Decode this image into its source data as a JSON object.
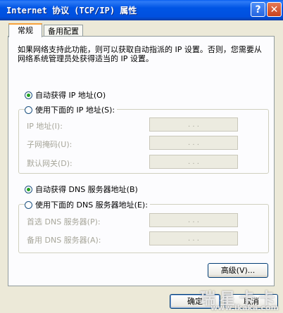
{
  "window": {
    "title": "Internet 协议 (TCP/IP) 属性",
    "help_label": "?",
    "close_label": "✕"
  },
  "tabs": [
    {
      "label": "常规",
      "active": true
    },
    {
      "label": "备用配置",
      "active": false
    }
  ],
  "description": "如果网络支持此功能，则可以获取自动指派的 IP 设置。否则，您需要从网络系统管理员处获得适当的 IP 设置。",
  "ip_section": {
    "auto_option": {
      "label": "自动获得 IP 地址(O)",
      "selected": true
    },
    "manual_option": {
      "label": "使用下面的 IP 地址(S):",
      "selected": false
    },
    "fields": [
      {
        "label": "IP 地址(I):",
        "value": ". . ."
      },
      {
        "label": "子网掩码(U):",
        "value": ". . ."
      },
      {
        "label": "默认网关(D):",
        "value": ". . ."
      }
    ]
  },
  "dns_section": {
    "auto_option": {
      "label": "自动获得 DNS 服务器地址(B)",
      "selected": true
    },
    "manual_option": {
      "label": "使用下面的 DNS 服务器地址(E):",
      "selected": false
    },
    "fields": [
      {
        "label": "首选 DNS 服务器(P):",
        "value": ". . ."
      },
      {
        "label": "备用 DNS 服务器(A):",
        "value": ". . ."
      }
    ]
  },
  "buttons": {
    "advanced": "高级(V)...",
    "ok": "确定",
    "cancel": "取消"
  },
  "watermark": {
    "brand": "瑞星卡卡",
    "url": "www.ikaka.com"
  },
  "colors": {
    "titlebar": "#0055e5",
    "dialog_bg": "#ece9d8",
    "radio_dot": "#21a121",
    "active_tab_accent": "#f7a13a"
  }
}
